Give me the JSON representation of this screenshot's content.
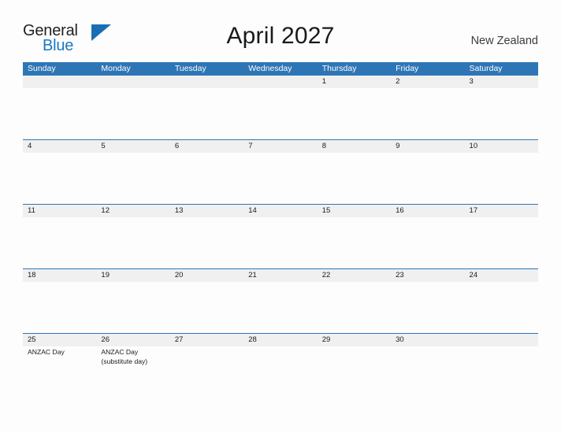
{
  "brand": {
    "name_part1": "General",
    "name_part2": "Blue",
    "flag_icon": "triangle-flag-icon",
    "color_dark": "#231f20",
    "color_blue": "#1b78c2"
  },
  "header": {
    "title": "April 2027",
    "region": "New Zealand"
  },
  "calendar": {
    "accent_color": "#2e75b6",
    "date_strip_color": "#f0f0f0",
    "weekdays": [
      "Sunday",
      "Monday",
      "Tuesday",
      "Wednesday",
      "Thursday",
      "Friday",
      "Saturday"
    ],
    "weeks": [
      {
        "days": [
          {
            "date": "",
            "events": []
          },
          {
            "date": "",
            "events": []
          },
          {
            "date": "",
            "events": []
          },
          {
            "date": "",
            "events": []
          },
          {
            "date": "1",
            "events": []
          },
          {
            "date": "2",
            "events": []
          },
          {
            "date": "3",
            "events": []
          }
        ]
      },
      {
        "days": [
          {
            "date": "4",
            "events": []
          },
          {
            "date": "5",
            "events": []
          },
          {
            "date": "6",
            "events": []
          },
          {
            "date": "7",
            "events": []
          },
          {
            "date": "8",
            "events": []
          },
          {
            "date": "9",
            "events": []
          },
          {
            "date": "10",
            "events": []
          }
        ]
      },
      {
        "days": [
          {
            "date": "11",
            "events": []
          },
          {
            "date": "12",
            "events": []
          },
          {
            "date": "13",
            "events": []
          },
          {
            "date": "14",
            "events": []
          },
          {
            "date": "15",
            "events": []
          },
          {
            "date": "16",
            "events": []
          },
          {
            "date": "17",
            "events": []
          }
        ]
      },
      {
        "days": [
          {
            "date": "18",
            "events": []
          },
          {
            "date": "19",
            "events": []
          },
          {
            "date": "20",
            "events": []
          },
          {
            "date": "21",
            "events": []
          },
          {
            "date": "22",
            "events": []
          },
          {
            "date": "23",
            "events": []
          },
          {
            "date": "24",
            "events": []
          }
        ]
      },
      {
        "days": [
          {
            "date": "25",
            "events": [
              "ANZAC Day"
            ]
          },
          {
            "date": "26",
            "events": [
              "ANZAC Day",
              "(substitute day)"
            ]
          },
          {
            "date": "27",
            "events": []
          },
          {
            "date": "28",
            "events": []
          },
          {
            "date": "29",
            "events": []
          },
          {
            "date": "30",
            "events": []
          },
          {
            "date": "",
            "events": []
          }
        ]
      }
    ]
  }
}
